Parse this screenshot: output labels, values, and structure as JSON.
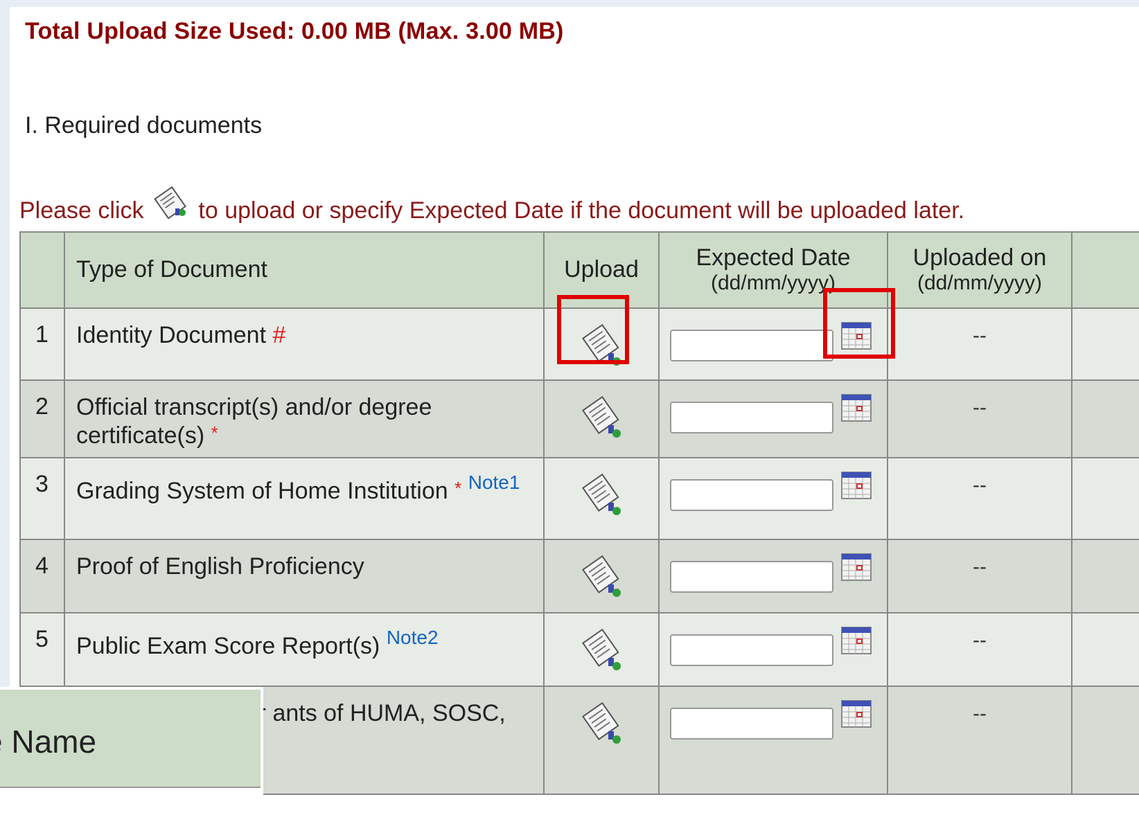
{
  "total_upload": "Total Upload Size Used: 0.00 MB (Max. 3.00 MB)",
  "section_title": "I.  Required documents",
  "instruction": {
    "before": "Please click",
    "after": " to upload or specify Expected Date if the document will be uploaded later."
  },
  "table": {
    "headers": {
      "num": "",
      "type": "Type of Document",
      "upload": "Upload",
      "expected": "Expected Date",
      "expected_fmt": "(dd/mm/yyyy)",
      "uploaded": "Uploaded on",
      "uploaded_fmt": "(dd/mm/yyyy)"
    },
    "rows": [
      {
        "num": "1",
        "type": "Identity Document",
        "mark": "#",
        "note": "",
        "expected": "",
        "uploaded": "--"
      },
      {
        "num": "2",
        "type": "Official transcript(s) and/or degree certificate(s)",
        "mark": "*",
        "note": "",
        "expected": "",
        "uploaded": "--"
      },
      {
        "num": "3",
        "type": "Grading System of Home Institution",
        "mark": "*",
        "note": "Note1",
        "expected": "",
        "uploaded": "--"
      },
      {
        "num": "4",
        "type": "Proof of English Proficiency",
        "mark": "",
        "note": "",
        "expected": "",
        "uploaded": "--"
      },
      {
        "num": "5",
        "type": "Public Exam Score Report(s)",
        "mark": "",
        "note": "Note2",
        "expected": "",
        "uploaded": "--"
      },
      {
        "num": "",
        "type": "sal (Mandatory for ants of HUMA, SOSC,",
        "mark": "",
        "note": "",
        "expected": "",
        "uploaded": "--"
      }
    ]
  },
  "popup": {
    "label": "e Name"
  },
  "colors": {
    "header_bg": "#ccdcc8",
    "highlight": "#e00000",
    "warning_text": "#8b1a1a"
  }
}
